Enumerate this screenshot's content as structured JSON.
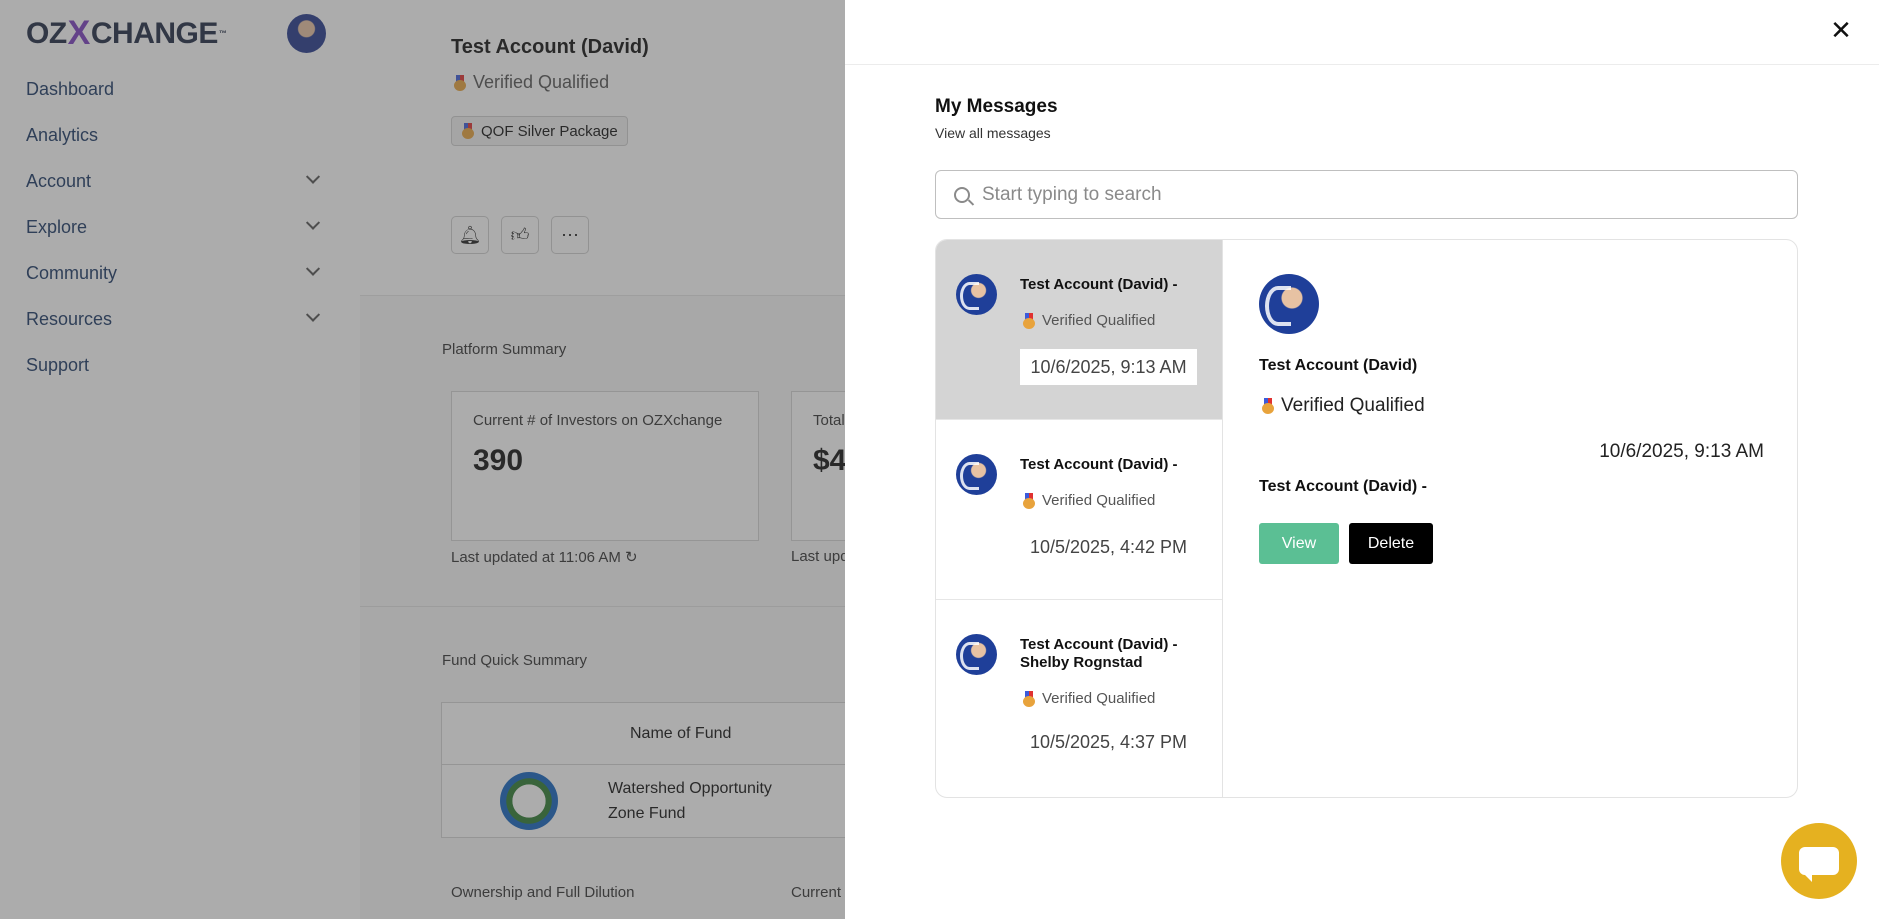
{
  "app": {
    "logo_left": "OZ",
    "logo_x": "X",
    "logo_right": "CHANGE",
    "logo_tm": "™"
  },
  "sidebar": {
    "items": [
      {
        "label": "Dashboard"
      },
      {
        "label": "Analytics"
      },
      {
        "label": "Account"
      },
      {
        "label": "Explore"
      },
      {
        "label": "Community"
      },
      {
        "label": "Resources"
      },
      {
        "label": "Support"
      }
    ]
  },
  "profile": {
    "name": "Test Account (David)",
    "verified": "Verified Qualified",
    "package": "QOF Silver Package"
  },
  "summary": {
    "label": "Platform Summary",
    "card1_caption": "Current # of Investors on OZXchange",
    "card1_value": "390",
    "card2_caption": "Total",
    "card2_value": "$4",
    "updated1": "Last updated at 11:06 AM",
    "updated2": "Last upd"
  },
  "fund": {
    "label": "Fund Quick Summary",
    "col_header": "Name of Fund",
    "row_name_line1": "Watershed Opportunity",
    "row_name_line2": "Zone Fund",
    "ownership_label": "Ownership and Full Dilution",
    "current_label": "Current"
  },
  "messages": {
    "title": "My Messages",
    "subtitle": "View all messages",
    "search_placeholder": "Start typing to search",
    "items": [
      {
        "name": "Test Account (David) -",
        "verified": "Verified Qualified",
        "date": "10/6/2025, 9:13 AM"
      },
      {
        "name": "Test Account (David) -",
        "verified": "Verified Qualified",
        "date": "10/5/2025, 4:42 PM"
      },
      {
        "name": "Test Account (David) - Shelby Rognstad",
        "verified": "Verified Qualified",
        "date": "10/5/2025, 4:37 PM"
      }
    ],
    "detail": {
      "name": "Test Account (David)",
      "verified": "Verified Qualified",
      "date": "10/6/2025, 9:13 AM",
      "subject": "Test Account (David) -",
      "view_label": "View",
      "delete_label": "Delete"
    }
  },
  "colors": {
    "accent_green": "#5bbf94",
    "chat_fab": "#e5b120",
    "selected_row": "#d4d4d4"
  }
}
